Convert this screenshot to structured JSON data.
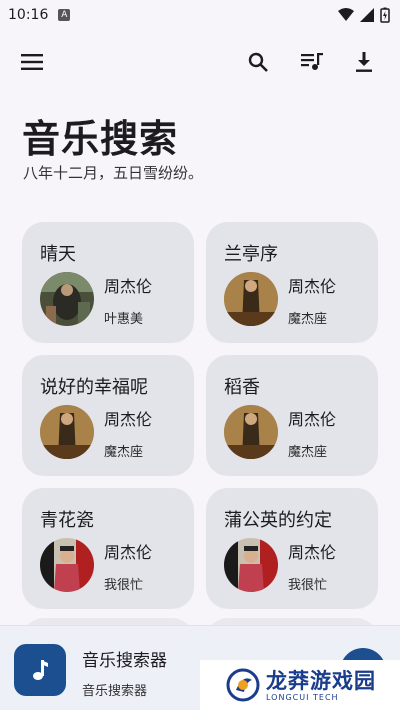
{
  "status_bar": {
    "time": "10:16",
    "notif_letter": "A"
  },
  "toolbar": {
    "menu_icon": "menu-icon",
    "search_icon": "search-icon",
    "queue_icon": "queue-music-icon",
    "download_icon": "download-icon"
  },
  "header": {
    "title": "音乐搜索",
    "subtitle": "八年十二月，五日雪纷纷。"
  },
  "cards": [
    {
      "title": "晴天",
      "artist": "周杰伦",
      "album": "叶惠美",
      "cover": "ye-hui-mei"
    },
    {
      "title": "兰亭序",
      "artist": "周杰伦",
      "album": "魔杰座",
      "cover": "mo-jie-zuo"
    },
    {
      "title": "说好的幸福呢",
      "artist": "周杰伦",
      "album": "魔杰座",
      "cover": "mo-jie-zuo"
    },
    {
      "title": "稻香",
      "artist": "周杰伦",
      "album": "魔杰座",
      "cover": "mo-jie-zuo"
    },
    {
      "title": "青花瓷",
      "artist": "周杰伦",
      "album": "我很忙",
      "cover": "wo-hen-mang"
    },
    {
      "title": "蒲公英的约定",
      "artist": "周杰伦",
      "album": "我很忙",
      "cover": "wo-hen-mang"
    }
  ],
  "player": {
    "title": "音乐搜索器",
    "subtitle": "音乐搜索器",
    "icon": "music-note-icon"
  },
  "watermark": {
    "main": "龙莽游戏园",
    "sub": "LONGCUI TECH"
  },
  "colors": {
    "background": "#f7f5fa",
    "card": "#e3e3ea",
    "accent": "#1c4f90",
    "player_bg": "#eef0f8"
  }
}
